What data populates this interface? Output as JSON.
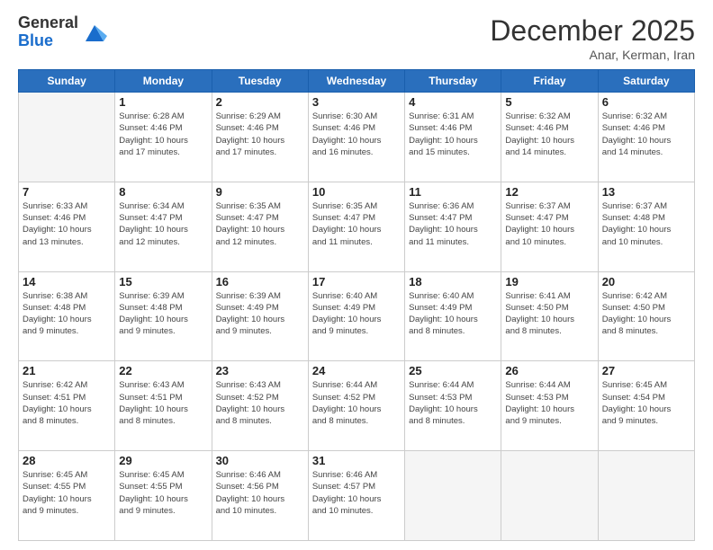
{
  "logo": {
    "general": "General",
    "blue": "Blue"
  },
  "header": {
    "month": "December 2025",
    "location": "Anar, Kerman, Iran"
  },
  "weekdays": [
    "Sunday",
    "Monday",
    "Tuesday",
    "Wednesday",
    "Thursday",
    "Friday",
    "Saturday"
  ],
  "weeks": [
    [
      {
        "day": "",
        "empty": true
      },
      {
        "day": "1",
        "sunrise": "6:28 AM",
        "sunset": "4:46 PM",
        "daylight": "10 hours and 17 minutes."
      },
      {
        "day": "2",
        "sunrise": "6:29 AM",
        "sunset": "4:46 PM",
        "daylight": "10 hours and 17 minutes."
      },
      {
        "day": "3",
        "sunrise": "6:30 AM",
        "sunset": "4:46 PM",
        "daylight": "10 hours and 16 minutes."
      },
      {
        "day": "4",
        "sunrise": "6:31 AM",
        "sunset": "4:46 PM",
        "daylight": "10 hours and 15 minutes."
      },
      {
        "day": "5",
        "sunrise": "6:32 AM",
        "sunset": "4:46 PM",
        "daylight": "10 hours and 14 minutes."
      },
      {
        "day": "6",
        "sunrise": "6:32 AM",
        "sunset": "4:46 PM",
        "daylight": "10 hours and 14 minutes."
      }
    ],
    [
      {
        "day": "7",
        "sunrise": "6:33 AM",
        "sunset": "4:46 PM",
        "daylight": "10 hours and 13 minutes."
      },
      {
        "day": "8",
        "sunrise": "6:34 AM",
        "sunset": "4:47 PM",
        "daylight": "10 hours and 12 minutes."
      },
      {
        "day": "9",
        "sunrise": "6:35 AM",
        "sunset": "4:47 PM",
        "daylight": "10 hours and 12 minutes."
      },
      {
        "day": "10",
        "sunrise": "6:35 AM",
        "sunset": "4:47 PM",
        "daylight": "10 hours and 11 minutes."
      },
      {
        "day": "11",
        "sunrise": "6:36 AM",
        "sunset": "4:47 PM",
        "daylight": "10 hours and 11 minutes."
      },
      {
        "day": "12",
        "sunrise": "6:37 AM",
        "sunset": "4:47 PM",
        "daylight": "10 hours and 10 minutes."
      },
      {
        "day": "13",
        "sunrise": "6:37 AM",
        "sunset": "4:48 PM",
        "daylight": "10 hours and 10 minutes."
      }
    ],
    [
      {
        "day": "14",
        "sunrise": "6:38 AM",
        "sunset": "4:48 PM",
        "daylight": "10 hours and 9 minutes."
      },
      {
        "day": "15",
        "sunrise": "6:39 AM",
        "sunset": "4:48 PM",
        "daylight": "10 hours and 9 minutes."
      },
      {
        "day": "16",
        "sunrise": "6:39 AM",
        "sunset": "4:49 PM",
        "daylight": "10 hours and 9 minutes."
      },
      {
        "day": "17",
        "sunrise": "6:40 AM",
        "sunset": "4:49 PM",
        "daylight": "10 hours and 9 minutes."
      },
      {
        "day": "18",
        "sunrise": "6:40 AM",
        "sunset": "4:49 PM",
        "daylight": "10 hours and 8 minutes."
      },
      {
        "day": "19",
        "sunrise": "6:41 AM",
        "sunset": "4:50 PM",
        "daylight": "10 hours and 8 minutes."
      },
      {
        "day": "20",
        "sunrise": "6:42 AM",
        "sunset": "4:50 PM",
        "daylight": "10 hours and 8 minutes."
      }
    ],
    [
      {
        "day": "21",
        "sunrise": "6:42 AM",
        "sunset": "4:51 PM",
        "daylight": "10 hours and 8 minutes."
      },
      {
        "day": "22",
        "sunrise": "6:43 AM",
        "sunset": "4:51 PM",
        "daylight": "10 hours and 8 minutes."
      },
      {
        "day": "23",
        "sunrise": "6:43 AM",
        "sunset": "4:52 PM",
        "daylight": "10 hours and 8 minutes."
      },
      {
        "day": "24",
        "sunrise": "6:44 AM",
        "sunset": "4:52 PM",
        "daylight": "10 hours and 8 minutes."
      },
      {
        "day": "25",
        "sunrise": "6:44 AM",
        "sunset": "4:53 PM",
        "daylight": "10 hours and 8 minutes."
      },
      {
        "day": "26",
        "sunrise": "6:44 AM",
        "sunset": "4:53 PM",
        "daylight": "10 hours and 9 minutes."
      },
      {
        "day": "27",
        "sunrise": "6:45 AM",
        "sunset": "4:54 PM",
        "daylight": "10 hours and 9 minutes."
      }
    ],
    [
      {
        "day": "28",
        "sunrise": "6:45 AM",
        "sunset": "4:55 PM",
        "daylight": "10 hours and 9 minutes."
      },
      {
        "day": "29",
        "sunrise": "6:45 AM",
        "sunset": "4:55 PM",
        "daylight": "10 hours and 9 minutes."
      },
      {
        "day": "30",
        "sunrise": "6:46 AM",
        "sunset": "4:56 PM",
        "daylight": "10 hours and 10 minutes."
      },
      {
        "day": "31",
        "sunrise": "6:46 AM",
        "sunset": "4:57 PM",
        "daylight": "10 hours and 10 minutes."
      },
      {
        "day": "",
        "empty": true
      },
      {
        "day": "",
        "empty": true
      },
      {
        "day": "",
        "empty": true
      }
    ]
  ]
}
